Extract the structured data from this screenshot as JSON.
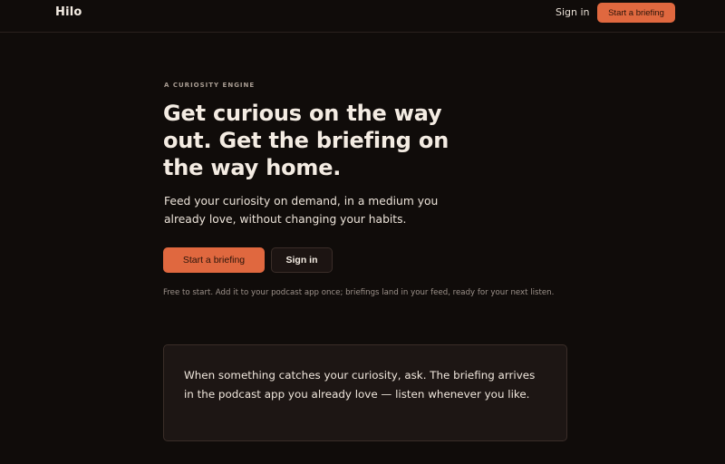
{
  "header": {
    "brand": "Hilo",
    "sign_in": "Sign in",
    "cta": "Start a briefing"
  },
  "hero": {
    "eyebrow": "A CURIOSITY ENGINE",
    "headline": "Get curious on the way out. Get the briefing on the way home.",
    "subhead": "Feed your curiosity on demand, in a medium you already love, without changing your habits.",
    "primary_button": "Start a briefing",
    "secondary_button": "Sign in",
    "fineprint": "Free to start. Add it to your podcast app once; briefings land in your feed, ready for your next listen."
  },
  "card": {
    "text": "When something catches your curiosity, ask. The briefing arrives in the podcast app you already love — listen whenever you like."
  },
  "colors": {
    "background": "#100c0a",
    "accent": "#e0683f",
    "card": "#1d1614"
  }
}
